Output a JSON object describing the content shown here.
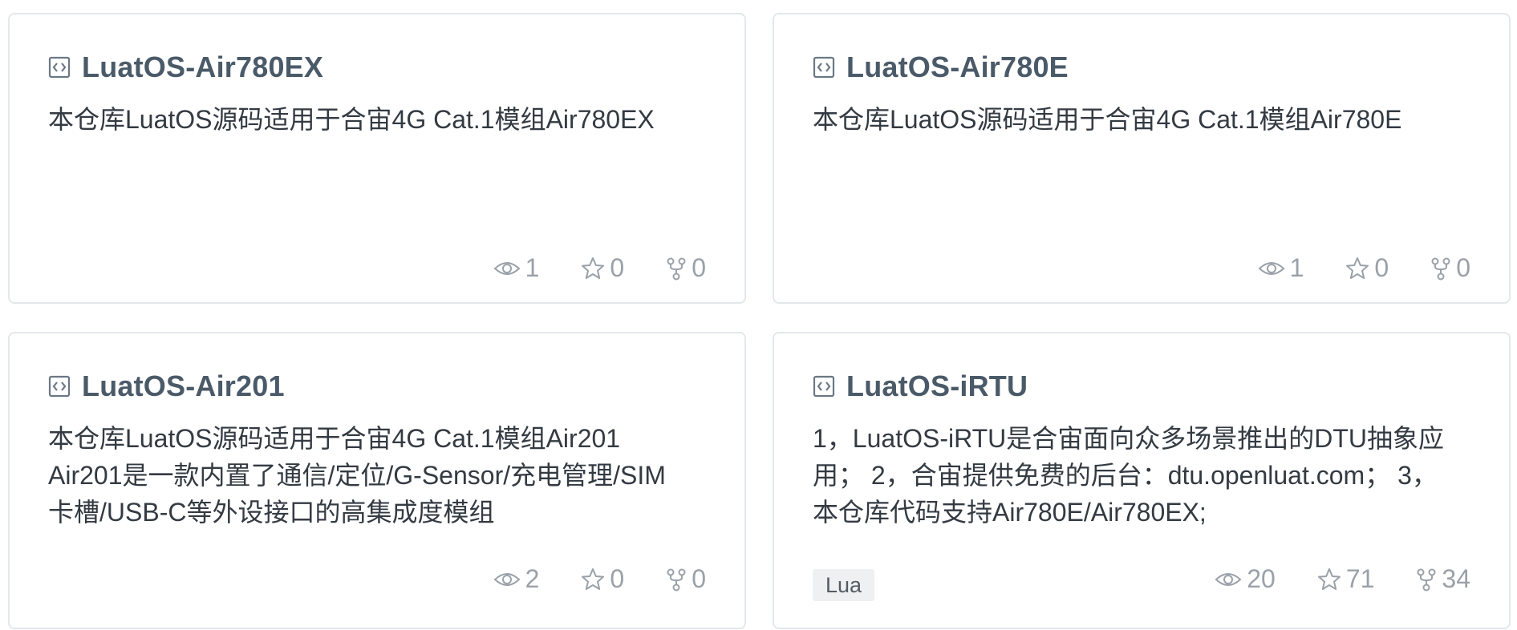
{
  "repos": [
    {
      "title": "LuatOS-Air780EX",
      "description": "本仓库LuatOS源码适用于合宙4G Cat.1模组Air780EX",
      "watchers": "1",
      "stars": "0",
      "forks": "0"
    },
    {
      "title": "LuatOS-Air780E",
      "description": "本仓库LuatOS源码适用于合宙4G Cat.1模组Air780E",
      "watchers": "1",
      "stars": "0",
      "forks": "0"
    },
    {
      "title": "LuatOS-Air201",
      "description": "本仓库LuatOS源码适用于合宙4G Cat.1模组Air201\nAir201是一款内置了通信/定位/G-Sensor/充电管理/SIM\n卡槽/USB-C等外设接口的高集成度模组",
      "watchers": "2",
      "stars": "0",
      "forks": "0"
    },
    {
      "title": "LuatOS-iRTU",
      "description": "1，LuatOS-iRTU是合宙面向众多场景推出的DTU抽象应\n用； 2，合宙提供免费的后台：dtu.openluat.com； 3，\n本仓库代码支持Air780E/Air780EX;",
      "language": "Lua",
      "watchers": "20",
      "stars": "71",
      "forks": "34"
    }
  ],
  "icons": {
    "repo": "repo-icon",
    "watch": "eye-icon",
    "star": "star-icon",
    "fork": "fork-icon"
  },
  "colors": {
    "title": "#4a5a68",
    "description": "#333a42",
    "stats": "#9aa1a8",
    "border": "#e4e7eb",
    "tag_bg": "#eef0f2"
  }
}
